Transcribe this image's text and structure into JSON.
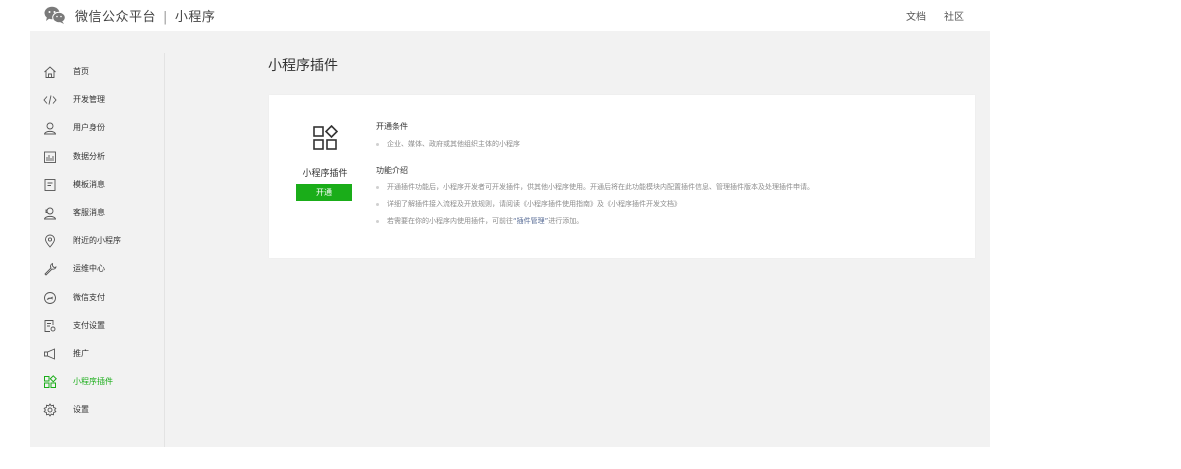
{
  "header": {
    "brand": "微信公众平台",
    "separator": "|",
    "product": "小程序",
    "links": [
      "文档",
      "社区"
    ]
  },
  "sidebar": {
    "items": [
      {
        "label": "首页",
        "icon": "home-icon"
      },
      {
        "label": "开发管理",
        "icon": "code-icon"
      },
      {
        "label": "用户身份",
        "icon": "user-icon"
      },
      {
        "label": "数据分析",
        "icon": "chart-icon"
      },
      {
        "label": "模板消息",
        "icon": "document-icon"
      },
      {
        "label": "客服消息",
        "icon": "customer-service-icon"
      },
      {
        "label": "附近的小程序",
        "icon": "location-pin-icon"
      },
      {
        "label": "运维中心",
        "icon": "wrench-icon"
      },
      {
        "label": "微信支付",
        "icon": "wechat-pay-icon"
      },
      {
        "label": "支付设置",
        "icon": "payment-settings-icon"
      },
      {
        "label": "推广",
        "icon": "megaphone-icon"
      },
      {
        "label": "小程序插件",
        "icon": "plugin-icon",
        "active": true
      },
      {
        "label": "设置",
        "icon": "gear-icon"
      }
    ]
  },
  "main": {
    "title": "小程序插件",
    "card": {
      "plugin_name": "小程序插件",
      "open_button": "开通",
      "conditions_title": "开通条件",
      "conditions": [
        "企业、媒体、政府或其他组织主体的小程序"
      ],
      "intro_title": "功能介绍",
      "intro_1": "开通插件功能后，小程序开发者可开发插件，供其他小程序使用。开通后将在此功能模块内配置插件信息、管理插件版本及处理插件申请。",
      "intro_2": "详细了解插件接入流程及开放规则，请阅读《小程序插件使用指南》及《小程序插件开发文档》",
      "intro_3_prefix": "若需要在你的小程序内使用插件，可前往",
      "intro_3_link": "“插件管理”",
      "intro_3_suffix": "进行添加。"
    }
  },
  "colors": {
    "accent": "#1aad19",
    "link": "#576b95",
    "panel_bg": "#f2f2f2"
  }
}
